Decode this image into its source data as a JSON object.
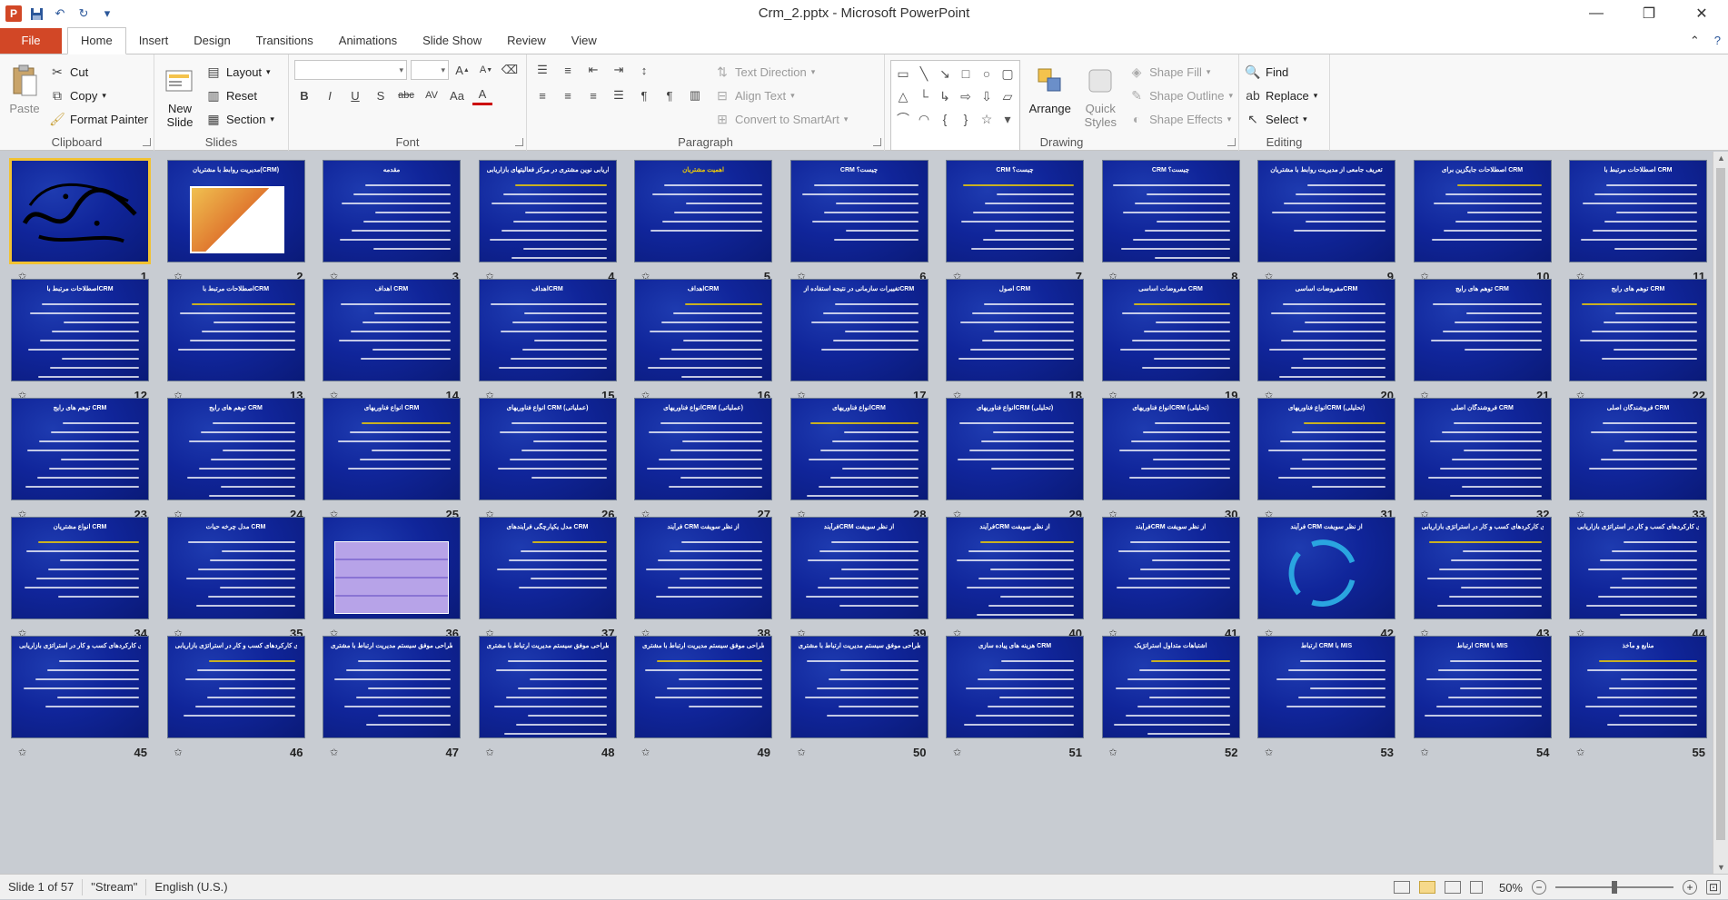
{
  "app": {
    "title": "Crm_2.pptx - Microsoft PowerPoint",
    "qat_icons": [
      "powerpoint-logo",
      "save-icon",
      "undo-icon",
      "redo-icon",
      "customize-qat-icon"
    ]
  },
  "tabs": [
    "File",
    "Home",
    "Insert",
    "Design",
    "Transitions",
    "Animations",
    "Slide Show",
    "Review",
    "View"
  ],
  "active_tab": "Home",
  "ribbon": {
    "clipboard": {
      "label": "Clipboard",
      "paste": "Paste",
      "cut": "Cut",
      "copy": "Copy",
      "format_painter": "Format Painter"
    },
    "slides": {
      "label": "Slides",
      "new_slide": "New Slide",
      "layout": "Layout",
      "reset": "Reset",
      "section": "Section"
    },
    "font": {
      "label": "Font",
      "font_name": "",
      "font_size": ""
    },
    "paragraph": {
      "label": "Paragraph",
      "text_direction": "Text Direction",
      "align_text": "Align Text",
      "convert_smartart": "Convert to SmartArt"
    },
    "drawing": {
      "label": "Drawing",
      "arrange": "Arrange",
      "quick_styles": "Quick Styles",
      "shape_fill": "Shape Fill",
      "shape_outline": "Shape Outline",
      "shape_effects": "Shape Effects"
    },
    "editing": {
      "label": "Editing",
      "find": "Find",
      "replace": "Replace",
      "select": "Select"
    }
  },
  "slides": [
    {
      "n": "1",
      "title": "",
      "style": "calligraphy"
    },
    {
      "n": "2",
      "title": "مدیریت روابط با مشتریان(CRM)",
      "style": "image"
    },
    {
      "n": "3",
      "title": "مقدمه",
      "style": "text"
    },
    {
      "n": "4",
      "title": "بازاریابی نوین مشتری در مرکز فعالیتهای بازاریابی",
      "style": "text"
    },
    {
      "n": "5",
      "title": "اهمیت مشتریان",
      "style": "yellow"
    },
    {
      "n": "6",
      "title": "CRM چیست؟",
      "style": "text"
    },
    {
      "n": "7",
      "title": "CRM چیست؟",
      "style": "text"
    },
    {
      "n": "8",
      "title": "CRM چیست؟",
      "style": "text"
    },
    {
      "n": "9",
      "title": "تعریف جامعی از مدیریت روابط با مشتریان",
      "style": "text"
    },
    {
      "n": "10",
      "title": "اصطلاحات جایگزین برای CRM",
      "style": "text"
    },
    {
      "n": "11",
      "title": "اصطلاحات مرتبط با CRM",
      "style": "text"
    },
    {
      "n": "12",
      "title": "اصطلاحات مرتبط باCRM",
      "style": "text"
    },
    {
      "n": "13",
      "title": "اصطلاحات مرتبط باCRM",
      "style": "text"
    },
    {
      "n": "14",
      "title": "اهداف CRM",
      "style": "text"
    },
    {
      "n": "15",
      "title": "اهدافCRM",
      "style": "text"
    },
    {
      "n": "16",
      "title": "اهدافCRM",
      "style": "text"
    },
    {
      "n": "17",
      "title": "تغییرات سازمانی در نتیجه استفاده ازCRM",
      "style": "text"
    },
    {
      "n": "18",
      "title": "اصول CRM",
      "style": "text"
    },
    {
      "n": "19",
      "title": "مفروضات اساسی CRM",
      "style": "text"
    },
    {
      "n": "20",
      "title": "مفروضات اساسیCRM",
      "style": "text"
    },
    {
      "n": "21",
      "title": "توهم های رایج CRM",
      "style": "text"
    },
    {
      "n": "22",
      "title": "توهم های رایج CRM",
      "style": "text"
    },
    {
      "n": "23",
      "title": "توهم های رایج CRM",
      "style": "text"
    },
    {
      "n": "24",
      "title": "توهم های رایج CRM",
      "style": "text"
    },
    {
      "n": "25",
      "title": "انواع فناوریهای CRM",
      "style": "text"
    },
    {
      "n": "26",
      "title": "انواع فناوریهای CRM (عملیاتی)",
      "style": "text"
    },
    {
      "n": "27",
      "title": "انواع فناوریهایCRM (عملیاتی)",
      "style": "text"
    },
    {
      "n": "28",
      "title": "انواع فناوریهایCRM",
      "style": "text"
    },
    {
      "n": "29",
      "title": "انواع فناوریهایCRM (تحلیلی)",
      "style": "text"
    },
    {
      "n": "30",
      "title": "انواع فناوریهایCRM (تحلیلی)",
      "style": "text"
    },
    {
      "n": "31",
      "title": "انواع فناوریهایCRM (تحلیلی)",
      "style": "text"
    },
    {
      "n": "32",
      "title": "فروشندگان اصلی CRM",
      "style": "text"
    },
    {
      "n": "33",
      "title": "فروشندگان اصلی CRM",
      "style": "text"
    },
    {
      "n": "34",
      "title": "انواع مشتریان CRM",
      "style": "text"
    },
    {
      "n": "35",
      "title": "مدل چرخه حیات CRM",
      "style": "text"
    },
    {
      "n": "36",
      "title": "",
      "style": "table"
    },
    {
      "n": "37",
      "title": "مدل یکپارچگی فرآیندهای CRM",
      "style": "text"
    },
    {
      "n": "38",
      "title": "فرآیند CRM از نظر سویفت",
      "style": "text"
    },
    {
      "n": "39",
      "title": "فرآیندCRM از نظر سویفت",
      "style": "text"
    },
    {
      "n": "40",
      "title": "فرآیندCRM از نظر سویفت",
      "style": "text"
    },
    {
      "n": "41",
      "title": "فرآیندCRM از نظر سویفت",
      "style": "text"
    },
    {
      "n": "42",
      "title": "فرآیند CRM از نظر سویفت",
      "style": "cycle"
    },
    {
      "n": "43",
      "title": "مدل یکپارچه سازی کارکردهای کسب و کار در استراتژی بازاریابی",
      "style": "text"
    },
    {
      "n": "44",
      "title": "مدل یکپارچه سازی کارکردهای کسب و کار در استراتژی بازاریابی",
      "style": "text"
    },
    {
      "n": "45",
      "title": "مدل یکپارچه سازی کارکردهای کسب و کار در استراتژی بازاریابی",
      "style": "text"
    },
    {
      "n": "46",
      "title": "مدل یکپارچه سازی کارکردهای کسب و کار در استراتژی بازاریابی",
      "style": "text"
    },
    {
      "n": "47",
      "title": "گامهای طراحی موفق سیستم مدیریت ارتباط با مشتری",
      "style": "text"
    },
    {
      "n": "48",
      "title": "گامهای طراحی موفق سیستم مدیریت ارتباط با مشتری",
      "style": "text"
    },
    {
      "n": "49",
      "title": "گامهای طراحی موفق سیستم مدیریت ارتباط با مشتری",
      "style": "text"
    },
    {
      "n": "50",
      "title": "گامهای طراحی موفق سیستم مدیریت ارتباط با مشتری",
      "style": "text"
    },
    {
      "n": "51",
      "title": "هزینه های پیاده سازی CRM",
      "style": "text"
    },
    {
      "n": "52",
      "title": "اشتباهات متداول استراتژیک",
      "style": "text"
    },
    {
      "n": "53",
      "title": "ارتباط CRM با MIS",
      "style": "text"
    },
    {
      "n": "54",
      "title": "ارتباط CRM با MIS",
      "style": "text"
    },
    {
      "n": "55",
      "title": "منابع و مآخذ",
      "style": "text"
    }
  ],
  "status": {
    "slide_info": "Slide 1 of 57",
    "theme": "\"Stream\"",
    "language": "English (U.S.)",
    "zoom": "50%"
  }
}
